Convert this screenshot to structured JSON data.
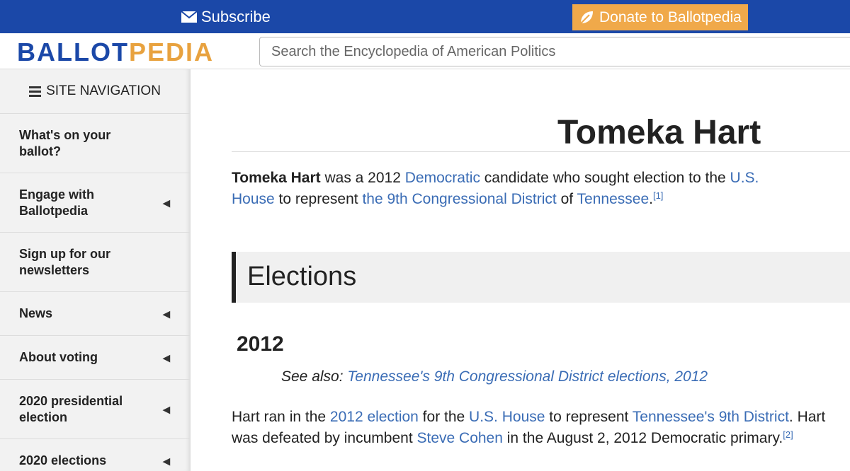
{
  "topbar": {
    "subscribe_label": "Subscribe",
    "donate_label": "Donate to Ballotpedia"
  },
  "header": {
    "logo_part1": "BALLOT",
    "logo_part2": "PEDIA",
    "search_placeholder": "Search the Encyclopedia of American Politics"
  },
  "sidebar": {
    "title": "SITE NAVIGATION",
    "items": [
      {
        "label": "What's on your ballot?",
        "has_arrow": false
      },
      {
        "label": "Engage with Ballotpedia",
        "has_arrow": true
      },
      {
        "label": "Sign up for our newsletters",
        "has_arrow": false
      },
      {
        "label": "News",
        "has_arrow": true
      },
      {
        "label": "About voting",
        "has_arrow": true
      },
      {
        "label": "2020 presidential election",
        "has_arrow": true
      },
      {
        "label": "2020 elections",
        "has_arrow": true
      }
    ],
    "arrow_glyph": "◀"
  },
  "article": {
    "title": "Tomeka Hart",
    "intro": {
      "name": "Tomeka Hart",
      "t1": " was a 2012 ",
      "link_democratic": "Democratic",
      "t2": " candidate who sought election to the ",
      "link_us_house": "U.S. House",
      "t3": " to represent ",
      "link_district": "the 9th Congressional District",
      "t4": " of ",
      "link_tennessee": "Tennessee",
      "t5": ".",
      "ref": "[1]"
    },
    "section_heading": "Elections",
    "year_heading": "2012",
    "see_also_label": "See also: ",
    "see_also_link": "Tennessee's 9th Congressional District elections, 2012",
    "para": {
      "t1": "Hart ran in the ",
      "link_election": "2012 election",
      "t2": " for the ",
      "link_house": "U.S. House",
      "t3": " to represent ",
      "link_tn9": "Tennessee's 9th District",
      "t4": ". Hart was defeated by incumbent ",
      "link_cohen": "Steve Cohen",
      "t5": " in the August 2, 2012 Democratic primary.",
      "ref": "[2]"
    }
  },
  "colors": {
    "topbar": "#1b48a8",
    "donate": "#f0a94a",
    "link": "#3a6cb5",
    "logo_blue": "#1b48a8",
    "logo_orange": "#e8a23f"
  }
}
